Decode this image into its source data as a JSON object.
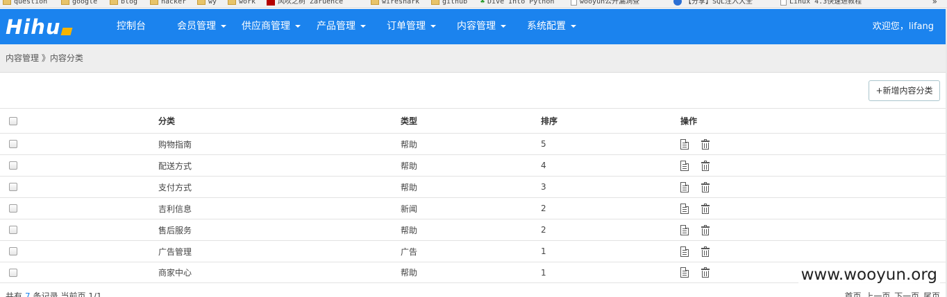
{
  "bookmarks": [
    {
      "label": "question",
      "icon": "folder-icon"
    },
    {
      "label": "google",
      "icon": "folder-icon"
    },
    {
      "label": "blog",
      "icon": "folder-icon"
    },
    {
      "label": "hacker",
      "icon": "folder-icon"
    },
    {
      "label": "wy",
      "icon": "folder-icon"
    },
    {
      "label": "work",
      "icon": "folder-icon"
    },
    {
      "label": "风吹之树 Zaruence",
      "icon": "site-icon"
    },
    {
      "label": "wireshark",
      "icon": "folder-icon"
    },
    {
      "label": "github",
      "icon": "folder-icon"
    },
    {
      "label": "Dive Into Python",
      "icon": "leaf-icon"
    },
    {
      "label": "wooyun公开漏洞查",
      "icon": "page-icon"
    },
    {
      "label": "【分享】SQL注入大全",
      "icon": "globe-icon"
    },
    {
      "label": "Linux 4.3快速进教程",
      "icon": "page-icon"
    }
  ],
  "navbar": {
    "logo": "Hihu",
    "items": [
      {
        "label": "控制台",
        "dropdown": false
      },
      {
        "label": "会员管理",
        "dropdown": true
      },
      {
        "label": "供应商管理",
        "dropdown": true
      },
      {
        "label": "产品管理",
        "dropdown": true
      },
      {
        "label": "订单管理",
        "dropdown": true
      },
      {
        "label": "内容管理",
        "dropdown": true
      },
      {
        "label": "系统配置",
        "dropdown": true
      }
    ],
    "welcome": "欢迎您，lifang"
  },
  "breadcrumb": "内容管理 》内容分类",
  "add_button": "+新增内容分类",
  "table": {
    "headers": {
      "category": "分类",
      "type": "类型",
      "sort": "排序",
      "ops": "操作"
    },
    "rows": [
      {
        "category": "购物指南",
        "type": "帮助",
        "sort": "5"
      },
      {
        "category": "配送方式",
        "type": "帮助",
        "sort": "4"
      },
      {
        "category": "支付方式",
        "type": "帮助",
        "sort": "3"
      },
      {
        "category": "吉利信息",
        "type": "新闻",
        "sort": "2"
      },
      {
        "category": "售后服务",
        "type": "帮助",
        "sort": "2"
      },
      {
        "category": "广告管理",
        "type": "广告",
        "sort": "1"
      },
      {
        "category": "商家中心",
        "type": "帮助",
        "sort": "1"
      }
    ]
  },
  "footer": {
    "prefix": "共有",
    "count": "7",
    "suffix": "条记录 当前页 1/1"
  },
  "pager": "首页 上一页 下一页 尾页",
  "watermark": "www.wooyun.org",
  "colors": {
    "navbar": "#1b83ee",
    "logo_accent": "#f5b400",
    "breadcrumb_bg": "#eeeeee"
  }
}
